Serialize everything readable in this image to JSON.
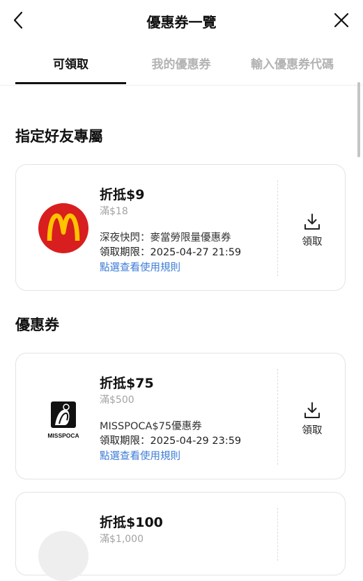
{
  "header": {
    "title": "優惠券一覽"
  },
  "tabs": [
    {
      "label": "可領取",
      "active": true
    },
    {
      "label": "我的優惠券",
      "active": false
    },
    {
      "label": "輸入優惠券代碼",
      "active": false
    }
  ],
  "sections": {
    "friends_only": {
      "title": "指定好友專屬",
      "coupons": [
        {
          "amount": "折抵$9",
          "minimum": "滿$18",
          "description": "深夜快閃：麥當勞限量優惠券",
          "period": "領取期限：2025-04-27 21:59",
          "rules_link": "點選查看使用規則",
          "claim_label": "領取",
          "logo": "mcdonalds-logo"
        }
      ]
    },
    "coupons": {
      "title": "優惠券",
      "coupons": [
        {
          "amount": "折抵$75",
          "minimum": "滿$500",
          "description": "MISSPOCA$75優惠券",
          "period": "領取期限：2025-04-29 23:59",
          "rules_link": "點選查看使用規則",
          "claim_label": "領取",
          "logo": "misspoca-logo",
          "logo_text": "MISSPOCA"
        },
        {
          "amount": "折抵$100",
          "minimum": "滿$1,000"
        }
      ]
    }
  },
  "colors": {
    "accent_link": "#3b7bd6",
    "mcdonalds_red": "#d81e1e",
    "mcdonalds_yellow": "#ffc300",
    "tab_inactive": "#b3b3b3"
  },
  "icons": {
    "back": "chevron-left-icon",
    "close": "close-icon",
    "claim": "download-icon"
  }
}
